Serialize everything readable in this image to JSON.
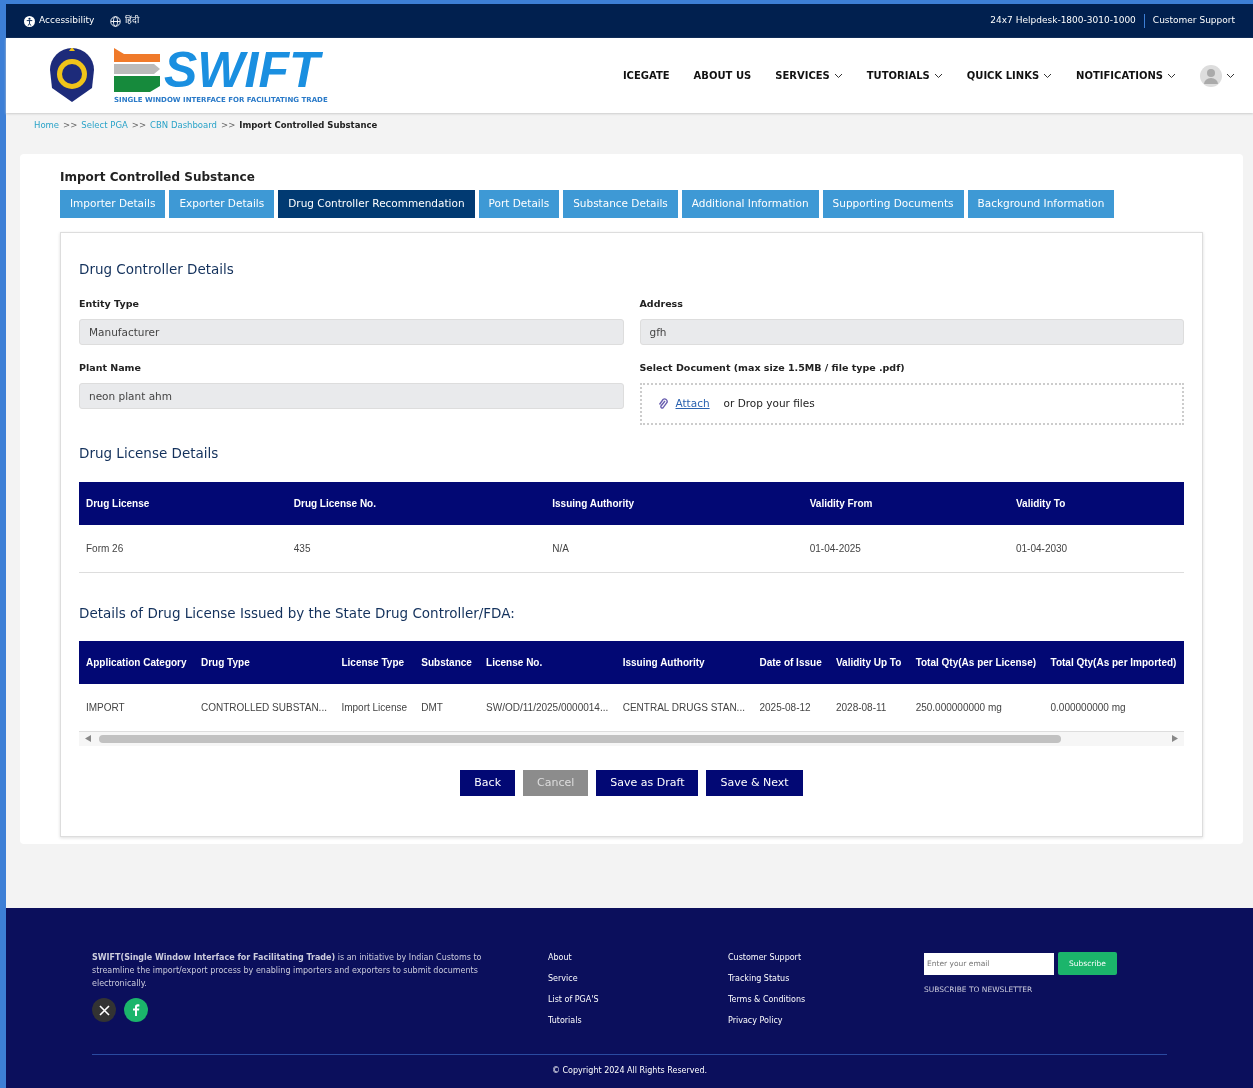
{
  "topbar": {
    "left": [
      {
        "kind": "accessibility",
        "label": "Accessibility"
      },
      {
        "kind": "language",
        "label": "हिंदी"
      }
    ],
    "helpdesk": "24x7 Helpdesk-1800-3010-1000",
    "support": "Customer Support"
  },
  "header": {
    "logo_text": "SWIFT",
    "logo_tagline": "SINGLE WINDOW INTERFACE FOR FACILITATING TRADE",
    "nav": [
      {
        "label": "ICEGATE",
        "dropdown": false
      },
      {
        "label": "ABOUT US",
        "dropdown": false
      },
      {
        "label": "SERVICES",
        "dropdown": true
      },
      {
        "label": "TUTORIALS",
        "dropdown": true
      },
      {
        "label": "QUICK LINKS",
        "dropdown": true
      },
      {
        "label": "NOTIFICATIONS",
        "dropdown": true
      }
    ]
  },
  "breadcrumb": [
    {
      "label": "Home",
      "link": true
    },
    {
      "label": ">>",
      "link": false,
      "kind": "separator"
    },
    {
      "label": "Select PGA",
      "link": true
    },
    {
      "label": ">>",
      "link": false,
      "kind": "separator"
    },
    {
      "label": "CBN Dashboard",
      "link": true
    },
    {
      "label": ">>",
      "link": false,
      "kind": "separator"
    },
    {
      "label": "Import Controlled Substance",
      "link": false
    }
  ],
  "form_title": "Import Controlled Substance",
  "tabs": [
    {
      "label": "Importer Details",
      "selected": false
    },
    {
      "label": "Exporter Details",
      "selected": false
    },
    {
      "label": "Drug Controller Recommendation",
      "selected": true
    },
    {
      "label": "Port Details",
      "selected": false
    },
    {
      "label": "Substance Details",
      "selected": false
    },
    {
      "label": "Additional Information",
      "selected": false
    },
    {
      "label": "Supporting Documents",
      "selected": false
    },
    {
      "label": "Background Information",
      "selected": false
    }
  ],
  "drug_controller": {
    "heading": "Drug Controller Details",
    "fields": [
      {
        "label": "Entity Type",
        "value": "Manufacturer"
      },
      {
        "label": "Address",
        "value": "gfh"
      },
      {
        "label": "Plant Name",
        "value": "neon plant ahm"
      }
    ],
    "upload": {
      "label": "Select Document (max size 1.5MB / file type .pdf)",
      "link": "Attach",
      "hint": "or Drop your files"
    }
  },
  "license_table": {
    "heading": "Drug License Details",
    "columns": [
      "Drug License",
      "Drug License No.",
      "Issuing Authority",
      "Validity From",
      "Validity To"
    ],
    "rows": [
      [
        "Form 26",
        "435",
        "N/A",
        "01-04-2025",
        "01-04-2030"
      ]
    ]
  },
  "state_table": {
    "heading": "Details of Drug License Issued by the State Drug Controller/FDA:",
    "columns": [
      "Application Category",
      "Drug Type",
      "License Type",
      "Substance",
      "License No.",
      "Issuing Authority",
      "Date of Issue",
      "Validity Up To",
      "Total Qty(As per License)",
      "Total Qty(As per Imported)"
    ],
    "rows": [
      [
        "IMPORT",
        "CONTROLLED SUBSTAN...",
        "Import License",
        "DMT",
        "SW/OD/11/2025/0000014...",
        "CENTRAL DRUGS STAN...",
        "2025-08-12",
        "2028-08-11",
        "250.000000000 mg",
        "0.000000000 mg"
      ]
    ]
  },
  "buttons": [
    {
      "label": "Back",
      "disabled": false
    },
    {
      "label": "Cancel",
      "disabled": true
    },
    {
      "label": "Save as Draft",
      "disabled": false
    },
    {
      "label": "Save & Next",
      "disabled": false
    }
  ],
  "footer": {
    "about": "**SWIFT(Single Window Interface for Facilitating Trade)** is an initiative by Indian Customs to streamline the import/export process by enabling importers and exporters to submit documents electronically.",
    "social": [
      {
        "kind": "x"
      },
      {
        "kind": "facebook"
      }
    ],
    "links_1": [
      "About",
      "Service",
      "List of PGA'S",
      "Tutorials"
    ],
    "links_2": [
      "Customer Support",
      "Tracking Status",
      "Terms & Conditions",
      "Privacy Policy"
    ],
    "email_placeholder": "Enter your email",
    "subscribe": "Subscribe",
    "newsletter": "SUBSCRIBE TO NEWSLETTER",
    "copyright": "© Copyright 2024 All Rights Reserved."
  }
}
